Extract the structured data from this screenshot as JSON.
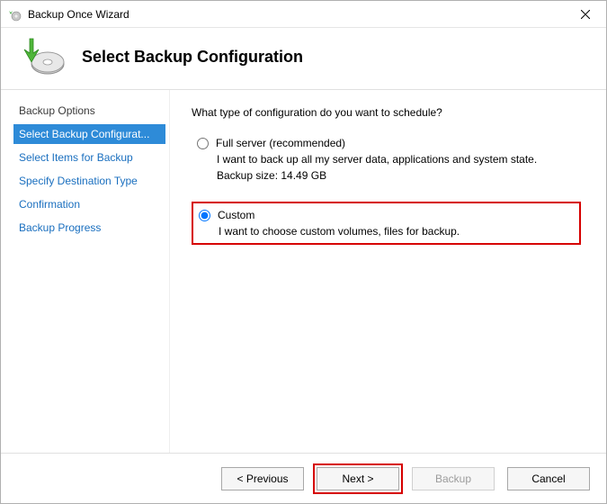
{
  "titlebar": {
    "title": "Backup Once Wizard"
  },
  "header": {
    "title": "Select Backup Configuration"
  },
  "sidebar": {
    "steps": [
      {
        "label": "Backup Options",
        "state": "done"
      },
      {
        "label": "Select Backup Configurat...",
        "state": "current"
      },
      {
        "label": "Select Items for Backup",
        "state": "pending"
      },
      {
        "label": "Specify Destination Type",
        "state": "pending"
      },
      {
        "label": "Confirmation",
        "state": "pending"
      },
      {
        "label": "Backup Progress",
        "state": "pending"
      }
    ]
  },
  "content": {
    "question": "What type of configuration do you want to schedule?",
    "options": [
      {
        "id": "full",
        "label": "Full server (recommended)",
        "description": "I want to back up all my server data, applications and system state.",
        "extra": "Backup size: 14.49 GB",
        "selected": false,
        "highlighted": false
      },
      {
        "id": "custom",
        "label": "Custom",
        "description": "I want to choose custom volumes, files for backup.",
        "extra": "",
        "selected": true,
        "highlighted": true
      }
    ]
  },
  "footer": {
    "previous": "< Previous",
    "next": "Next >",
    "backup": "Backup",
    "cancel": "Cancel"
  }
}
